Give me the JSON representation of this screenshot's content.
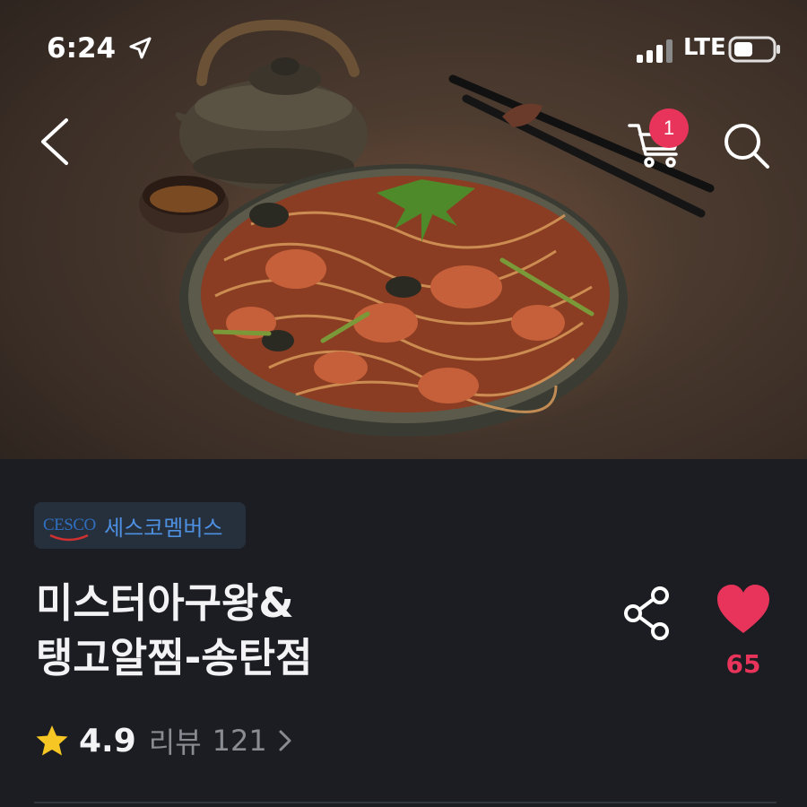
{
  "status_bar": {
    "time": "6:24",
    "network": "LTE",
    "icons": [
      "location-arrow-icon",
      "signal-icon",
      "battery-icon"
    ]
  },
  "nav": {
    "back_icon": "back-chevron-icon",
    "cart_icon": "cart-icon",
    "cart_badge": "1",
    "search_icon": "search-icon"
  },
  "hero": {
    "image": "food-photo"
  },
  "store": {
    "brand_logo_text": "CESCO",
    "brand_name": "세스코멤버스",
    "title_line1": "미스터아구왕&",
    "title_line2": "탱고알찜-송탄점",
    "like_count": "65",
    "rating": "4.9",
    "review_label": "리뷰",
    "review_count": "121"
  },
  "colors": {
    "background": "#1c1d22",
    "accent": "#e8345a",
    "star": "#f6c624",
    "brand_blue": "#4d8fe0",
    "muted_text": "#8a8c93"
  }
}
